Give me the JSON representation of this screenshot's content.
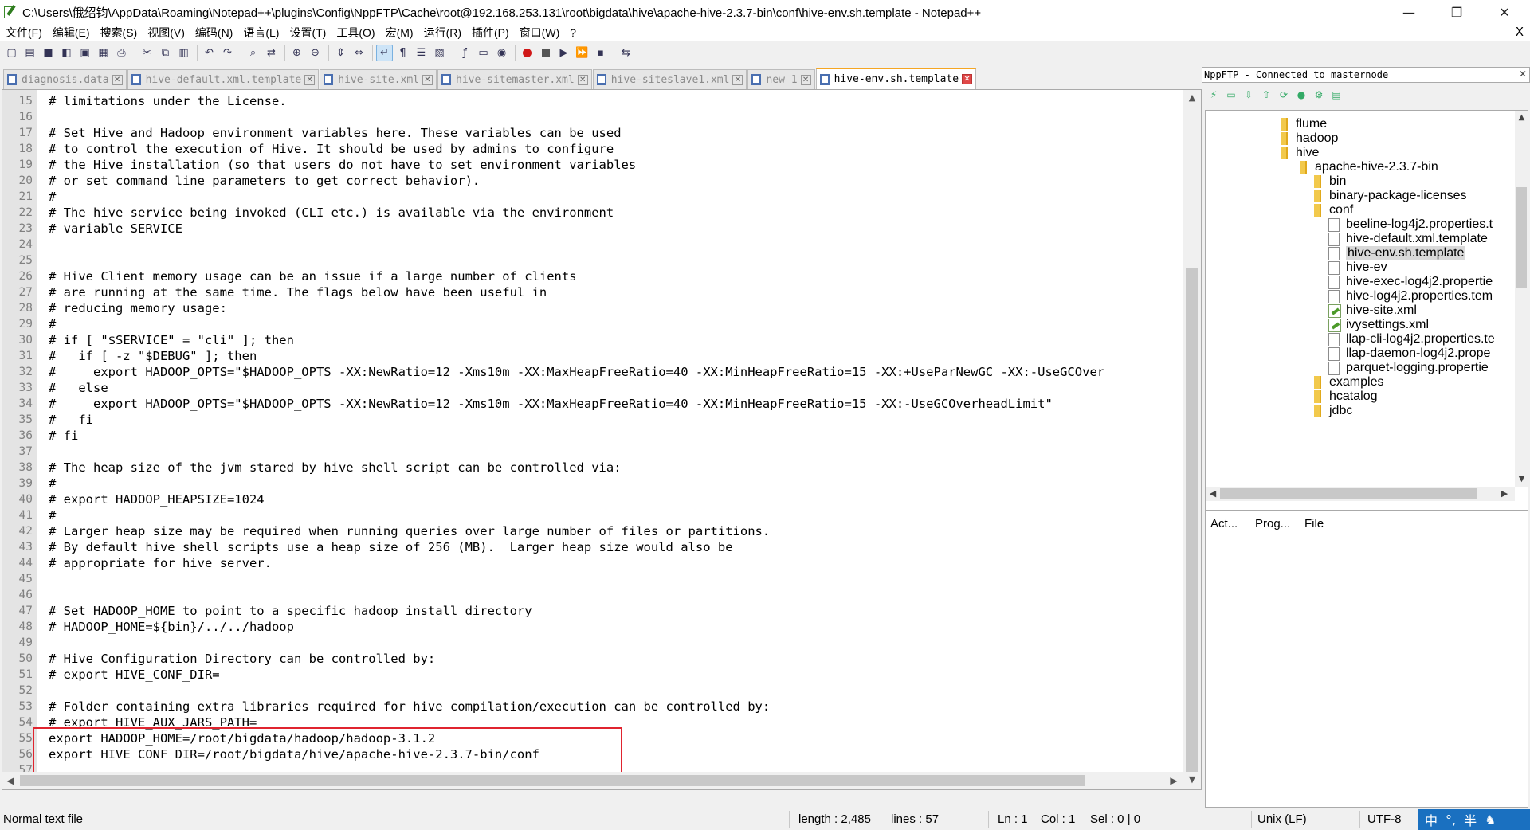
{
  "window": {
    "title": "C:\\Users\\俄绍钧\\AppData\\Roaming\\Notepad++\\plugins\\Config\\NppFTP\\Cache\\root@192.168.253.131\\root\\bigdata\\hive\\apache-hive-2.3.7-bin\\conf\\hive-env.sh.template - Notepad++",
    "minimize": "—",
    "maximize": "❐",
    "close": "✕"
  },
  "menu": {
    "items": [
      "文件(F)",
      "编辑(E)",
      "搜索(S)",
      "视图(V)",
      "编码(N)",
      "语言(L)",
      "设置(T)",
      "工具(O)",
      "宏(M)",
      "运行(R)",
      "插件(P)",
      "窗口(W)",
      "?"
    ],
    "doc_close": "X"
  },
  "toolbar": {
    "buttons": [
      {
        "icon": "new-file-icon",
        "glyph": "▢"
      },
      {
        "icon": "open-file-icon",
        "glyph": "▤"
      },
      {
        "icon": "save-icon",
        "glyph": "■"
      },
      {
        "icon": "save-all-icon",
        "glyph": "◧"
      },
      {
        "icon": "close-file-icon",
        "glyph": "▣"
      },
      {
        "icon": "close-all-icon",
        "glyph": "▦"
      },
      {
        "icon": "print-icon",
        "glyph": "⎙"
      },
      {
        "icon": "cut-icon",
        "glyph": "✂"
      },
      {
        "icon": "copy-icon",
        "glyph": "⧉"
      },
      {
        "icon": "paste-icon",
        "glyph": "▥"
      },
      {
        "icon": "undo-icon",
        "glyph": "↶"
      },
      {
        "icon": "redo-icon",
        "glyph": "↷"
      },
      {
        "icon": "find-icon",
        "glyph": "⌕"
      },
      {
        "icon": "replace-icon",
        "glyph": "⇄"
      },
      {
        "icon": "zoom-in-icon",
        "glyph": "⊕"
      },
      {
        "icon": "zoom-out-icon",
        "glyph": "⊖"
      },
      {
        "icon": "sync-vertical-icon",
        "glyph": "⇕"
      },
      {
        "icon": "sync-horizontal-icon",
        "glyph": "⇔"
      },
      {
        "icon": "word-wrap-icon",
        "glyph": "↵"
      },
      {
        "icon": "show-all-chars-icon",
        "glyph": "¶"
      },
      {
        "icon": "indent-guide-icon",
        "glyph": "☰"
      },
      {
        "icon": "doc-map-icon",
        "glyph": "▧"
      },
      {
        "icon": "function-list-icon",
        "glyph": "ƒ"
      },
      {
        "icon": "folder-workspace-icon",
        "glyph": "▭"
      },
      {
        "icon": "monitoring-icon",
        "glyph": "◉"
      },
      {
        "icon": "macro-record-icon",
        "glyph": "rec"
      },
      {
        "icon": "macro-stop-icon",
        "glyph": "stop"
      },
      {
        "icon": "macro-play-icon",
        "glyph": "▶"
      },
      {
        "icon": "macro-play-multiple-icon",
        "glyph": "⏩"
      },
      {
        "icon": "macro-save-icon",
        "glyph": "▪"
      },
      {
        "icon": "nppftp-icon",
        "glyph": "⇆"
      }
    ]
  },
  "tabs": [
    {
      "label": "diagnosis.data",
      "active": false
    },
    {
      "label": "hive-default.xml.template",
      "active": false
    },
    {
      "label": "hive-site.xml",
      "active": false
    },
    {
      "label": "hive-sitemaster.xml",
      "active": false
    },
    {
      "label": "hive-siteslave1.xml",
      "active": false
    },
    {
      "label": "new 1",
      "active": false
    },
    {
      "label": "hive-env.sh.template",
      "active": true
    }
  ],
  "editor": {
    "lines": [
      {
        "n": "15",
        "text": "# limitations under the License."
      },
      {
        "n": "16",
        "text": ""
      },
      {
        "n": "17",
        "text": "# Set Hive and Hadoop environment variables here. These variables can be used"
      },
      {
        "n": "18",
        "text": "# to control the execution of Hive. It should be used by admins to configure"
      },
      {
        "n": "19",
        "text": "# the Hive installation (so that users do not have to set environment variables"
      },
      {
        "n": "20",
        "text": "# or set command line parameters to get correct behavior)."
      },
      {
        "n": "21",
        "text": "#"
      },
      {
        "n": "22",
        "text": "# The hive service being invoked (CLI etc.) is available via the environment"
      },
      {
        "n": "23",
        "text": "# variable SERVICE"
      },
      {
        "n": "24",
        "text": ""
      },
      {
        "n": "25",
        "text": ""
      },
      {
        "n": "26",
        "text": "# Hive Client memory usage can be an issue if a large number of clients"
      },
      {
        "n": "27",
        "text": "# are running at the same time. The flags below have been useful in"
      },
      {
        "n": "28",
        "text": "# reducing memory usage:"
      },
      {
        "n": "29",
        "text": "#"
      },
      {
        "n": "30",
        "text": "# if [ \"$SERVICE\" = \"cli\" ]; then"
      },
      {
        "n": "31",
        "text": "#   if [ -z \"$DEBUG\" ]; then"
      },
      {
        "n": "32",
        "text": "#     export HADOOP_OPTS=\"$HADOOP_OPTS -XX:NewRatio=12 -Xms10m -XX:MaxHeapFreeRatio=40 -XX:MinHeapFreeRatio=15 -XX:+UseParNewGC -XX:-UseGCOver"
      },
      {
        "n": "33",
        "text": "#   else"
      },
      {
        "n": "34",
        "text": "#     export HADOOP_OPTS=\"$HADOOP_OPTS -XX:NewRatio=12 -Xms10m -XX:MaxHeapFreeRatio=40 -XX:MinHeapFreeRatio=15 -XX:-UseGCOverheadLimit\""
      },
      {
        "n": "35",
        "text": "#   fi"
      },
      {
        "n": "36",
        "text": "# fi"
      },
      {
        "n": "37",
        "text": ""
      },
      {
        "n": "38",
        "text": "# The heap size of the jvm stared by hive shell script can be controlled via:"
      },
      {
        "n": "39",
        "text": "#"
      },
      {
        "n": "40",
        "text": "# export HADOOP_HEAPSIZE=1024"
      },
      {
        "n": "41",
        "text": "#"
      },
      {
        "n": "42",
        "text": "# Larger heap size may be required when running queries over large number of files or partitions."
      },
      {
        "n": "43",
        "text": "# By default hive shell scripts use a heap size of 256 (MB).  Larger heap size would also be"
      },
      {
        "n": "44",
        "text": "# appropriate for hive server."
      },
      {
        "n": "45",
        "text": ""
      },
      {
        "n": "46",
        "text": ""
      },
      {
        "n": "47",
        "text": "# Set HADOOP_HOME to point to a specific hadoop install directory"
      },
      {
        "n": "48",
        "text": "# HADOOP_HOME=${bin}/../../hadoop"
      },
      {
        "n": "49",
        "text": ""
      },
      {
        "n": "50",
        "text": "# Hive Configuration Directory can be controlled by:"
      },
      {
        "n": "51",
        "text": "# export HIVE_CONF_DIR="
      },
      {
        "n": "52",
        "text": ""
      },
      {
        "n": "53",
        "text": "# Folder containing extra libraries required for hive compilation/execution can be controlled by:"
      },
      {
        "n": "54",
        "text": "# export HIVE_AUX_JARS_PATH="
      },
      {
        "n": "55",
        "text": "export HADOOP_HOME=/root/bigdata/hadoop/hadoop-3.1.2"
      },
      {
        "n": "56",
        "text": "export HIVE_CONF_DIR=/root/bigdata/hive/apache-hive-2.3.7-bin/conf"
      },
      {
        "n": "57",
        "text": ""
      }
    ]
  },
  "ftp": {
    "header": "NppFTP - Connected to masternode",
    "close": "✕",
    "toolbar": [
      {
        "icon": "connect-icon",
        "glyph": "⚡"
      },
      {
        "icon": "open-directory-icon",
        "glyph": "▭"
      },
      {
        "icon": "download-icon",
        "glyph": "⇩"
      },
      {
        "icon": "upload-icon",
        "glyph": "⇧"
      },
      {
        "icon": "refresh-icon",
        "glyph": "⟳"
      },
      {
        "icon": "abort-icon",
        "glyph": "●"
      },
      {
        "icon": "settings-icon",
        "glyph": "⚙"
      },
      {
        "icon": "message-window-icon",
        "glyph": "▤"
      }
    ],
    "tree": [
      {
        "label": "flume",
        "type": "folder",
        "level": 0
      },
      {
        "label": "hadoop",
        "type": "folder",
        "level": 0
      },
      {
        "label": "hive",
        "type": "folder",
        "level": 0
      },
      {
        "label": "apache-hive-2.3.7-bin",
        "type": "folder",
        "level": 1
      },
      {
        "label": "bin",
        "type": "folder",
        "level": 2
      },
      {
        "label": "binary-package-licenses",
        "type": "folder",
        "level": 2
      },
      {
        "label": "conf",
        "type": "folder",
        "level": 2
      },
      {
        "label": "beeline-log4j2.properties.t",
        "type": "file",
        "level": 3
      },
      {
        "label": "hive-default.xml.template",
        "type": "file",
        "level": 3
      },
      {
        "label": "hive-env.sh.template",
        "type": "file",
        "level": 3,
        "selected": true
      },
      {
        "label": "hive-ev",
        "type": "file",
        "level": 3
      },
      {
        "label": "hive-exec-log4j2.propertie",
        "type": "file",
        "level": 3
      },
      {
        "label": "hive-log4j2.properties.tem",
        "type": "file",
        "level": 3
      },
      {
        "label": "hive-site.xml",
        "type": "xml",
        "level": 3
      },
      {
        "label": "ivysettings.xml",
        "type": "xml",
        "level": 3
      },
      {
        "label": "llap-cli-log4j2.properties.te",
        "type": "file",
        "level": 3
      },
      {
        "label": "llap-daemon-log4j2.prope",
        "type": "file",
        "level": 3
      },
      {
        "label": "parquet-logging.propertie",
        "type": "file",
        "level": 3
      },
      {
        "label": "examples",
        "type": "folder",
        "level": 2
      },
      {
        "label": "hcatalog",
        "type": "folder",
        "level": 2
      },
      {
        "label": "jdbc",
        "type": "folder",
        "level": 2
      }
    ],
    "queue_columns": [
      "Act...",
      "Prog...",
      "File"
    ]
  },
  "status": {
    "file_type": "Normal text file",
    "length": "length : 2,485",
    "lines": "lines : 57",
    "ln": "Ln : 1",
    "col": "Col : 1",
    "sel": "Sel : 0 | 0",
    "eol": "Unix (LF)",
    "encoding": "UTF-8"
  },
  "ime": {
    "mode": "中",
    "punct": "°,",
    "width": "半"
  },
  "colors": {
    "highlight_box": "#e0242f",
    "active_tab_accent": "#f5a623"
  }
}
